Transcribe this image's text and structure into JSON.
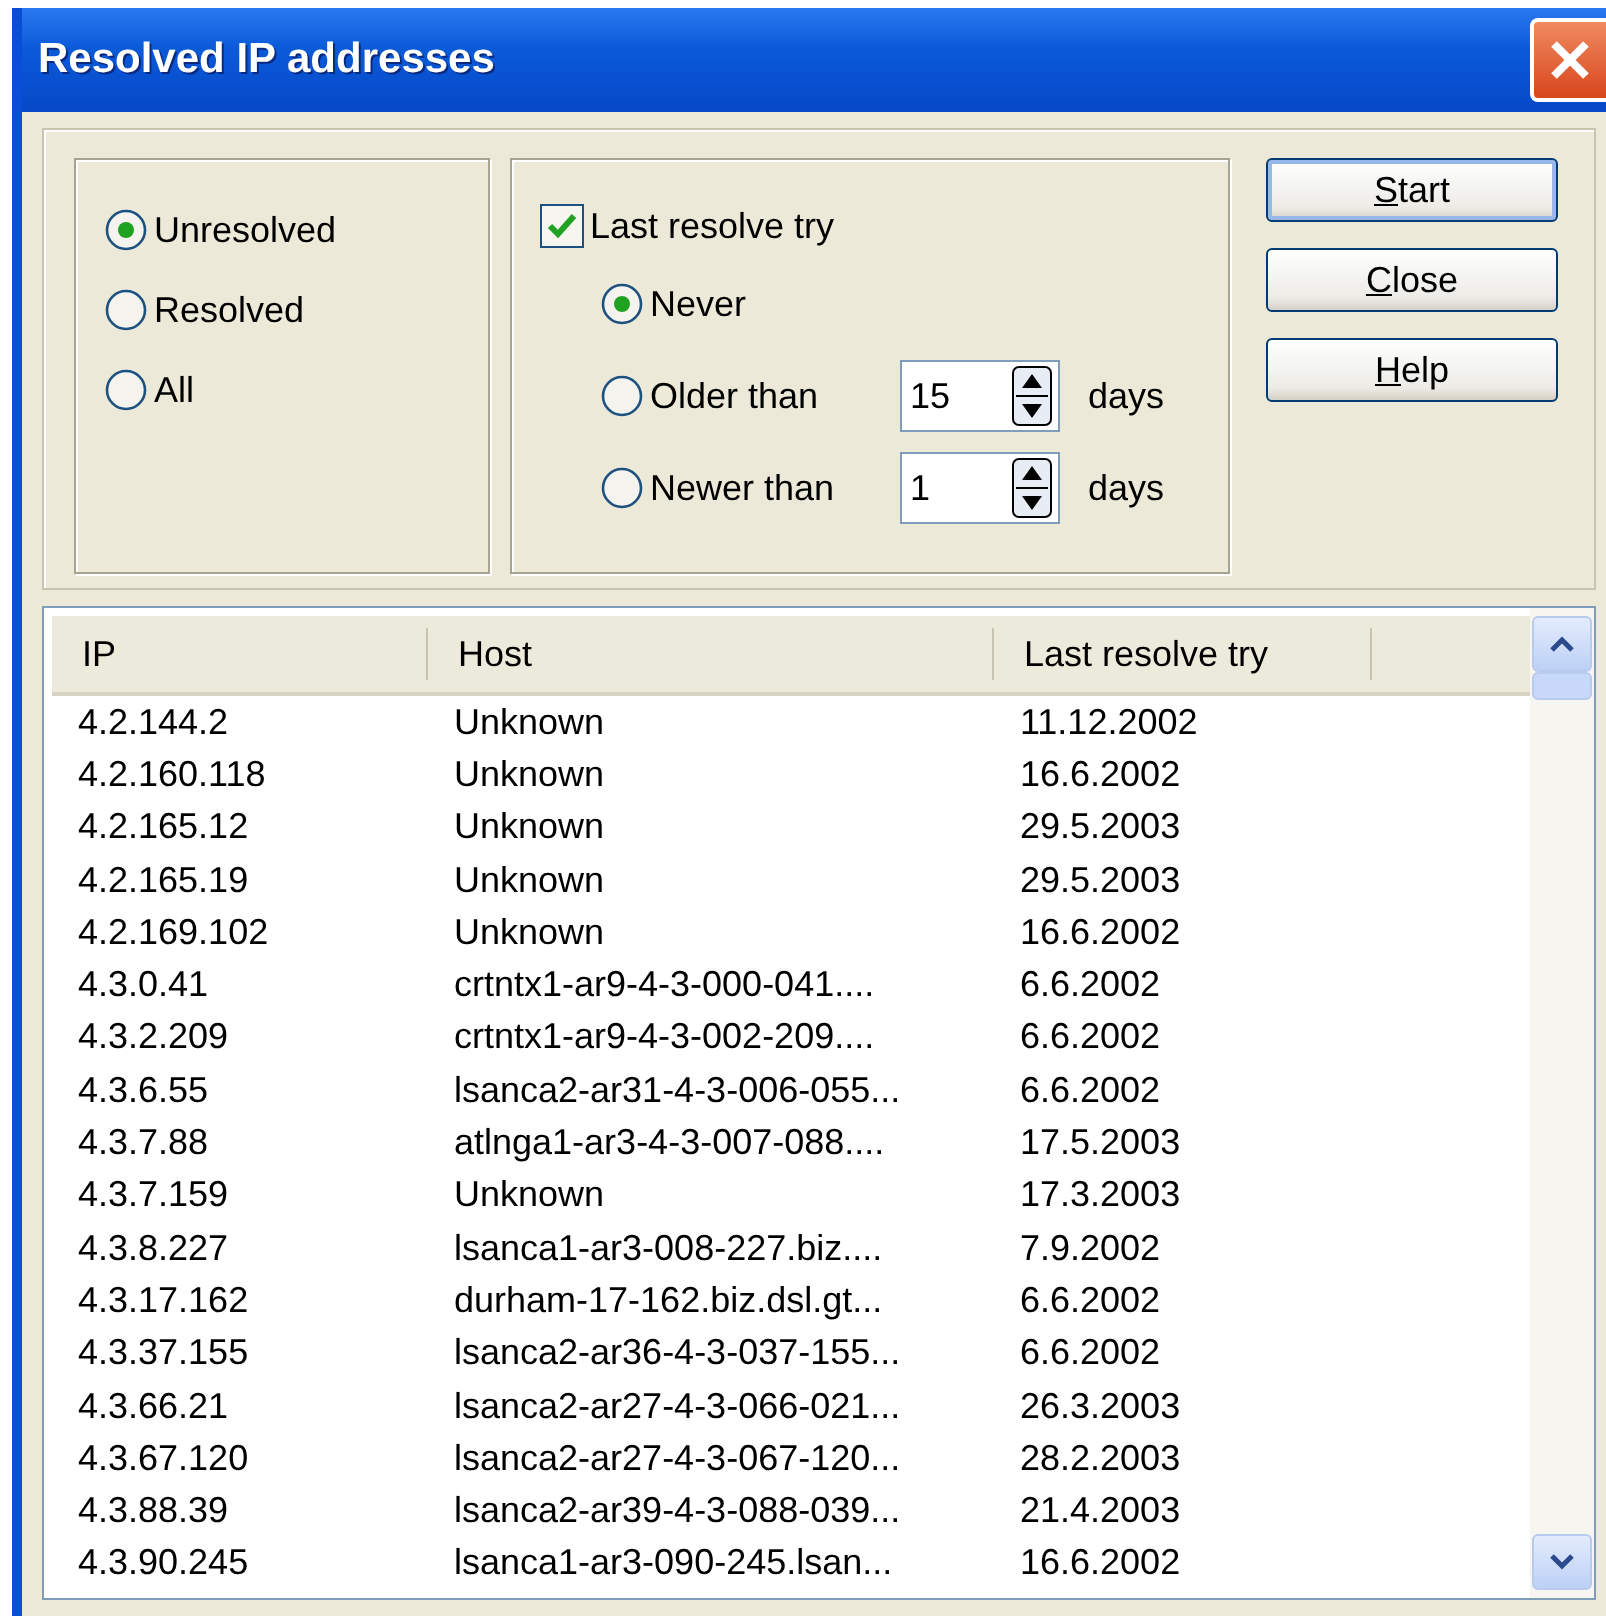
{
  "window": {
    "title": "Resolved IP addresses"
  },
  "status_filter": [
    {
      "label": "Unresolved",
      "selected": true
    },
    {
      "label": "Resolved",
      "selected": false
    },
    {
      "label": "All",
      "selected": false
    }
  ],
  "last_resolve": {
    "label": "Last resolve try",
    "checked": true,
    "options": [
      {
        "kind": "plain",
        "label": "Never",
        "selected": true
      },
      {
        "kind": "days",
        "label": "Older than",
        "selected": false,
        "value": "15",
        "unit": "days"
      },
      {
        "kind": "days",
        "label": "Newer than",
        "selected": false,
        "value": "1",
        "unit": "days"
      }
    ]
  },
  "buttons": [
    {
      "mnemonic": "S",
      "rest": "tart",
      "default": true
    },
    {
      "mnemonic": "C",
      "rest": "lose",
      "default": false
    },
    {
      "mnemonic": "H",
      "rest": "elp",
      "default": false
    }
  ],
  "table": {
    "columns": [
      "IP",
      "Host",
      "Last resolve try"
    ],
    "rows": [
      [
        "4.2.144.2",
        "Unknown",
        "11.12.2002"
      ],
      [
        "4.2.160.118",
        "Unknown",
        "16.6.2002"
      ],
      [
        "4.2.165.12",
        "Unknown",
        "29.5.2003"
      ],
      [
        "4.2.165.19",
        "Unknown",
        "29.5.2003"
      ],
      [
        "4.2.169.102",
        "Unknown",
        "16.6.2002"
      ],
      [
        "4.3.0.41",
        "crtntx1-ar9-4-3-000-041....",
        "6.6.2002"
      ],
      [
        "4.3.2.209",
        "crtntx1-ar9-4-3-002-209....",
        "6.6.2002"
      ],
      [
        "4.3.6.55",
        "lsanca2-ar31-4-3-006-055...",
        "6.6.2002"
      ],
      [
        "4.3.7.88",
        "atlnga1-ar3-4-3-007-088....",
        "17.5.2003"
      ],
      [
        "4.3.7.159",
        "Unknown",
        "17.3.2003"
      ],
      [
        "4.3.8.227",
        "lsanca1-ar3-008-227.biz....",
        "7.9.2002"
      ],
      [
        "4.3.17.162",
        "durham-17-162.biz.dsl.gt...",
        "6.6.2002"
      ],
      [
        "4.3.37.155",
        "lsanca2-ar36-4-3-037-155...",
        "6.6.2002"
      ],
      [
        "4.3.66.21",
        "lsanca2-ar27-4-3-066-021...",
        "26.3.2003"
      ],
      [
        "4.3.67.120",
        "lsanca2-ar27-4-3-067-120...",
        "28.2.2003"
      ],
      [
        "4.3.88.39",
        "lsanca2-ar39-4-3-088-039...",
        "21.4.2003"
      ],
      [
        "4.3.90.245",
        "lsanca1-ar3-090-245.lsan...",
        "16.6.2002"
      ]
    ]
  }
}
